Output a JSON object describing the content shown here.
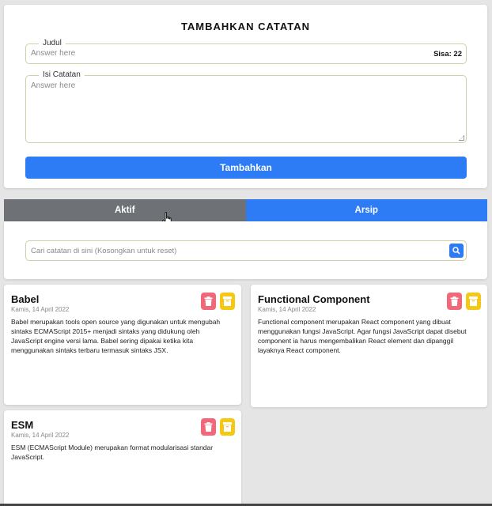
{
  "form": {
    "title": "TAMBAHKAN CATATAN",
    "judul": {
      "label": "Judul",
      "placeholder": "Answer here",
      "counter": "Sisa: 22"
    },
    "isi": {
      "label": "Isi Catatan",
      "placeholder": "Answer here"
    },
    "submit_label": "Tambahkan"
  },
  "tabs": [
    {
      "label": "Aktif",
      "active": true
    },
    {
      "label": "Arsip",
      "active": false
    }
  ],
  "search": {
    "placeholder": "Cari catatan di sini (Kosongkan untuk reset)",
    "icon": "search-icon"
  },
  "notes": [
    {
      "title": "Babel",
      "date": "Kamis, 14 April 2022",
      "body": "Babel merupakan tools open source yang digunakan untuk mengubah sintaks ECMAScript 2015+ menjadi sintaks yang didukung oleh JavaScript engine versi lama. Babel sering dipakai ketika kita menggunakan sintaks terbaru termasuk sintaks JSX."
    },
    {
      "title": "Functional Component",
      "date": "Kamis, 14 April 2022",
      "body": "Functional component merupakan React component yang dibuat menggunakan fungsi JavaScript. Agar fungsi JavaScript dapat disebut component ia harus mengembalikan React element dan dipanggil layaknya React component."
    },
    {
      "title": "ESM",
      "date": "Kamis, 14 April 2022",
      "body": "ESM (ECMAScript Module) merupakan format modularisasi standar JavaScript."
    }
  ],
  "colors": {
    "primary": "#2d7cf6",
    "tab_active": "#6e7276",
    "delete": "#f2687a",
    "archive": "#f5c814"
  }
}
